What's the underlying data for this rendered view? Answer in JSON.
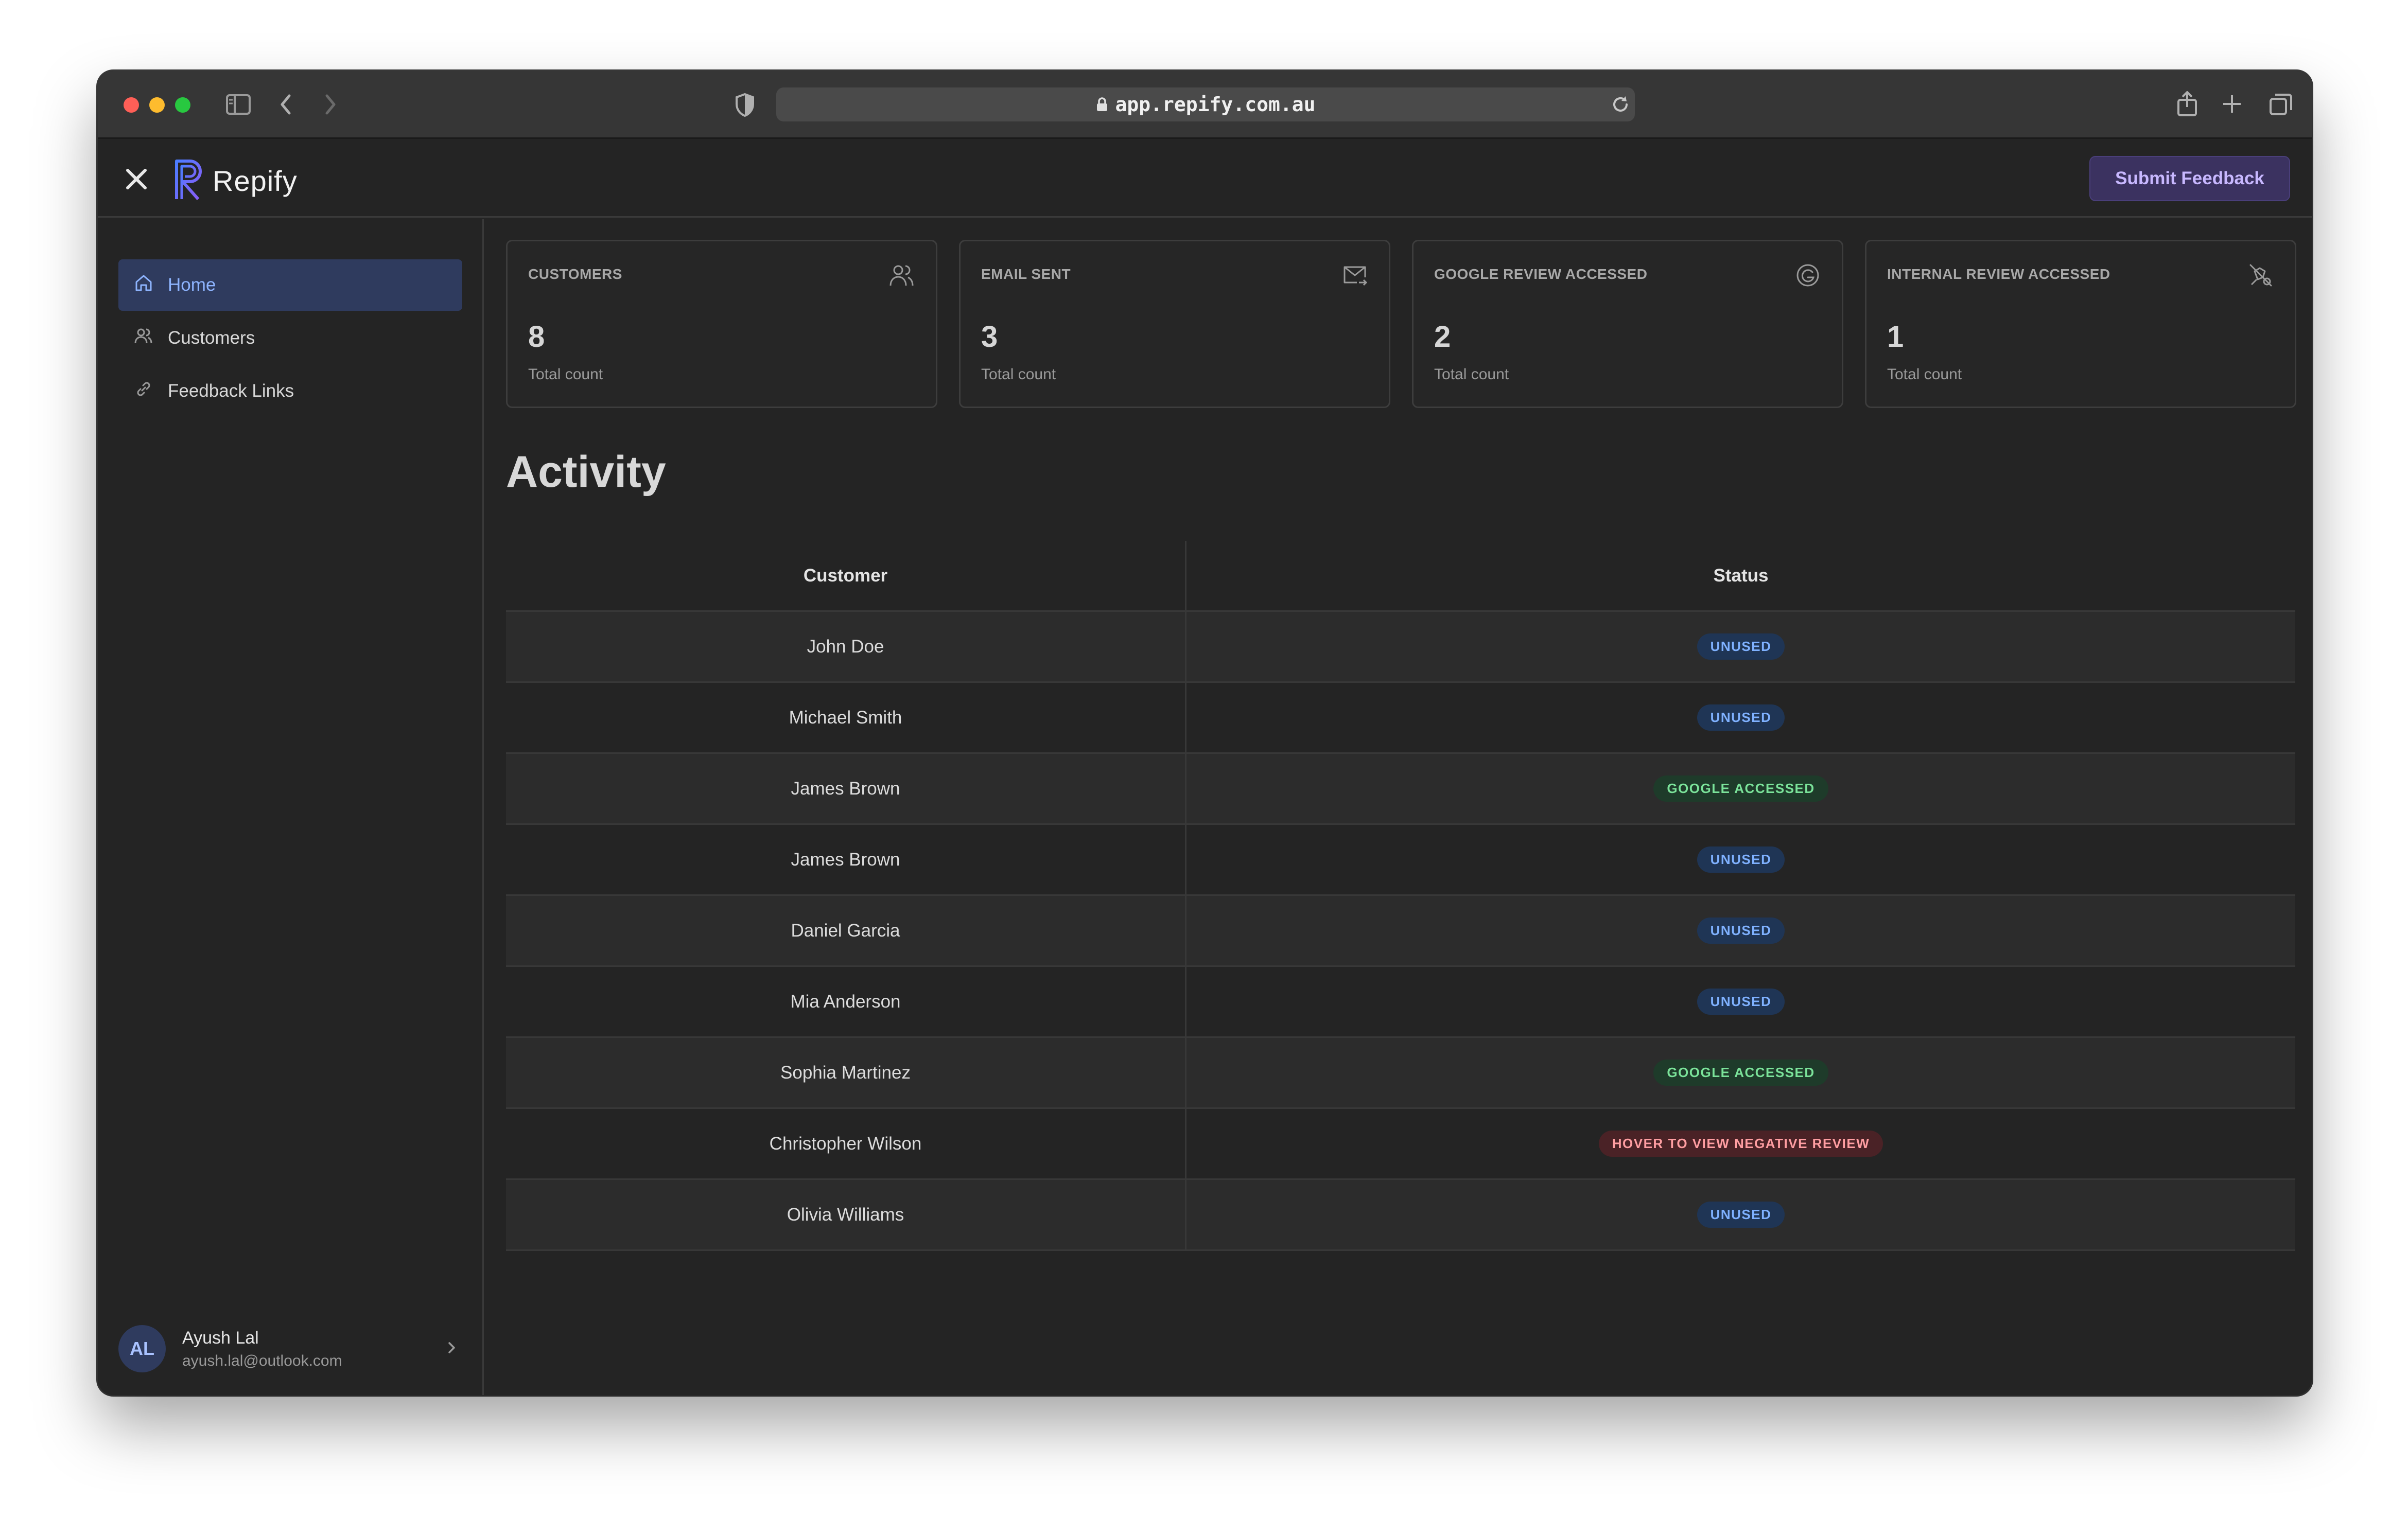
{
  "browser": {
    "url": "app.repify.com.au"
  },
  "header": {
    "app_name": "Repify",
    "submit_label": "Submit Feedback"
  },
  "sidebar": {
    "items": [
      {
        "label": "Home",
        "icon": "home-icon",
        "active": true
      },
      {
        "label": "Customers",
        "icon": "users-icon",
        "active": false
      },
      {
        "label": "Feedback Links",
        "icon": "link-icon",
        "active": false
      }
    ],
    "user": {
      "initials": "AL",
      "name": "Ayush Lal",
      "email": "ayush.lal@outlook.com"
    }
  },
  "stats": [
    {
      "title": "CUSTOMERS",
      "value": "8",
      "sub": "Total count",
      "icon": "users-icon"
    },
    {
      "title": "EMAIL SENT",
      "value": "3",
      "sub": "Total count",
      "icon": "mail-icon"
    },
    {
      "title": "GOOGLE REVIEW ACCESSED",
      "value": "2",
      "sub": "Total count",
      "icon": "google-icon"
    },
    {
      "title": "INTERNAL REVIEW ACCESSED",
      "value": "1",
      "sub": "Total count",
      "icon": "internal-review-icon"
    }
  ],
  "activity": {
    "title": "Activity",
    "columns": [
      "Customer",
      "Status"
    ],
    "rows": [
      {
        "customer": "John Doe",
        "status": "UNUSED",
        "kind": "unused"
      },
      {
        "customer": "Michael Smith",
        "status": "UNUSED",
        "kind": "unused"
      },
      {
        "customer": "James Brown",
        "status": "GOOGLE ACCESSED",
        "kind": "google"
      },
      {
        "customer": "James Brown",
        "status": "UNUSED",
        "kind": "unused"
      },
      {
        "customer": "Daniel Garcia",
        "status": "UNUSED",
        "kind": "unused"
      },
      {
        "customer": "Mia Anderson",
        "status": "UNUSED",
        "kind": "unused"
      },
      {
        "customer": "Sophia Martinez",
        "status": "GOOGLE ACCESSED",
        "kind": "google"
      },
      {
        "customer": "Christopher Wilson",
        "status": "HOVER TO VIEW NEGATIVE REVIEW",
        "kind": "neg"
      },
      {
        "customer": "Olivia Williams",
        "status": "UNUSED",
        "kind": "unused"
      }
    ]
  },
  "colors": {
    "accent": "#8eb4ff",
    "submit_bg": "#3b3260",
    "unused_badge": "#1f3555",
    "google_badge": "#1e3b2a",
    "negative_badge": "#4a2226"
  }
}
